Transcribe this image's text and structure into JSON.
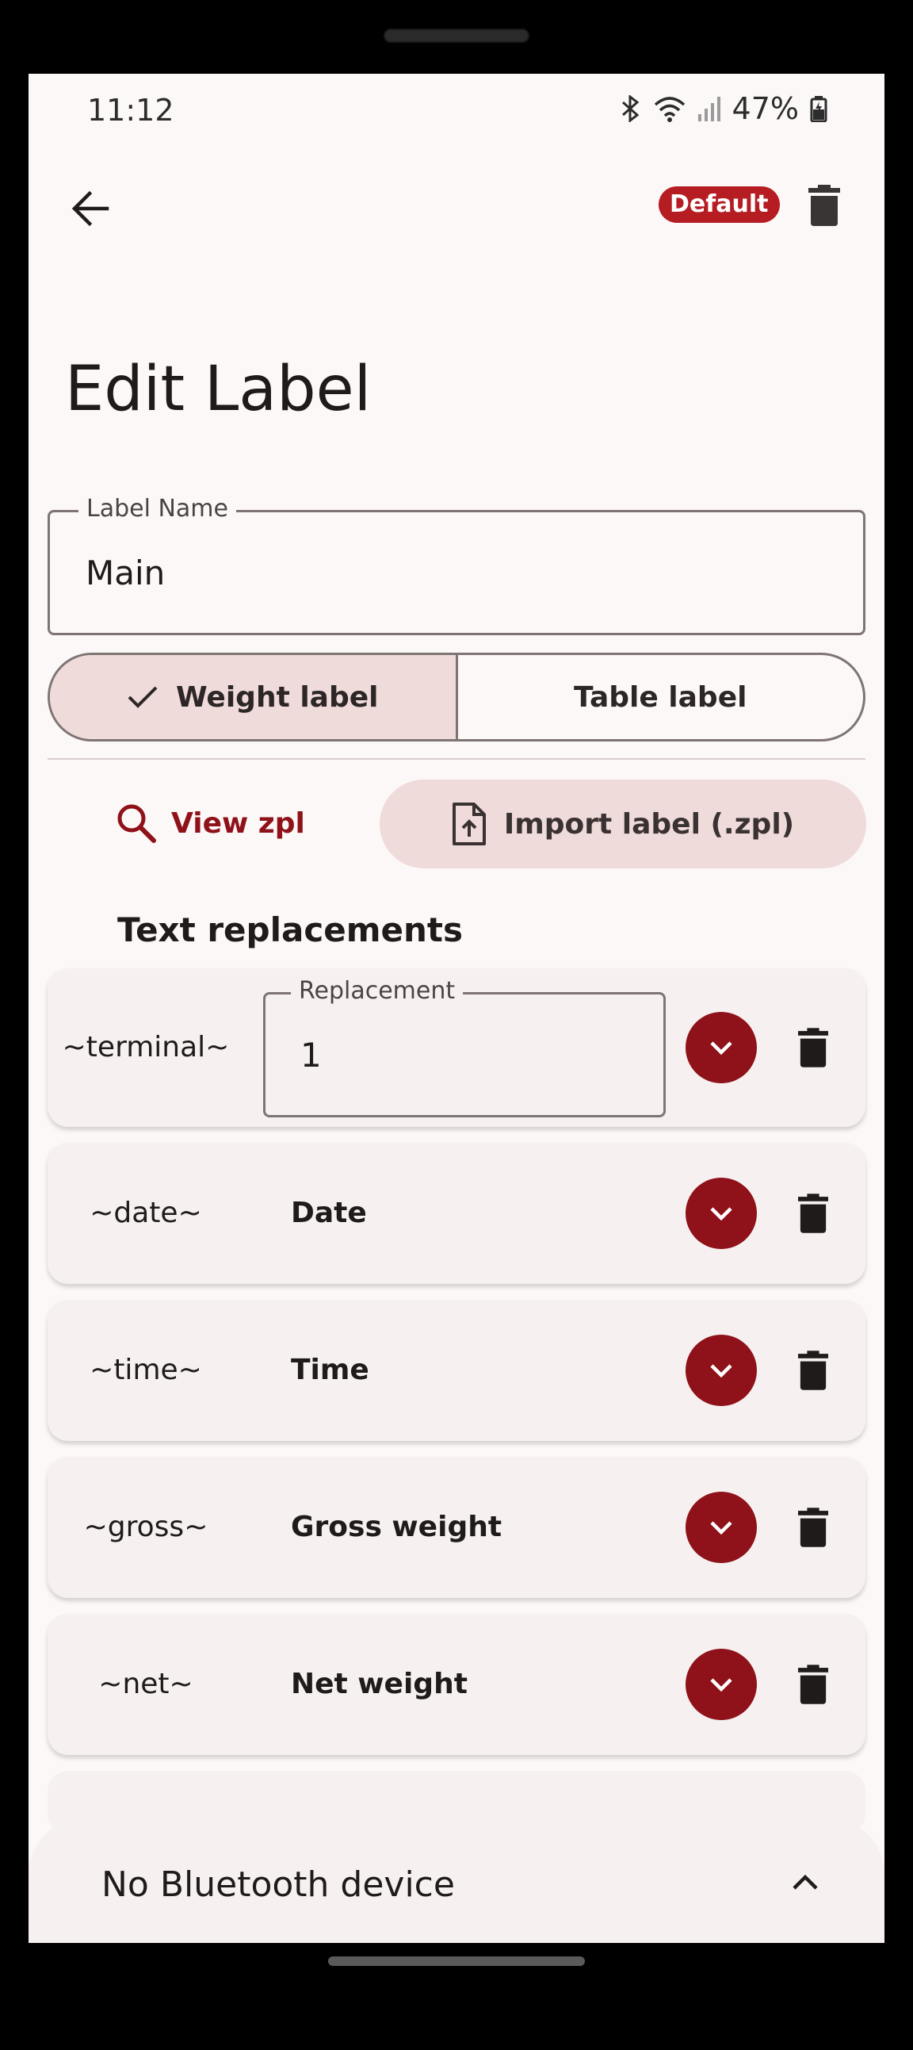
{
  "status_bar": {
    "time": "11:12",
    "battery": "47%"
  },
  "app_bar": {
    "badge": "Default"
  },
  "page": {
    "title": "Edit Label"
  },
  "label_name_field": {
    "label": "Label Name",
    "value": "Main"
  },
  "segmented": {
    "weight": "Weight label",
    "table": "Table label"
  },
  "actions": {
    "view_zpl": "View zpl",
    "import": "Import label (.zpl)"
  },
  "section": {
    "title": "Text replacements"
  },
  "replacements": [
    {
      "key": "~terminal~",
      "field_label": "Replacement",
      "value": "1"
    },
    {
      "key": "~date~",
      "desc": "Date"
    },
    {
      "key": "~time~",
      "desc": "Time"
    },
    {
      "key": "~gross~",
      "desc": "Gross weight"
    },
    {
      "key": "~net~",
      "desc": "Net weight"
    }
  ],
  "bluetooth": {
    "text": "No Bluetooth device"
  },
  "colors": {
    "accent": "#8f1119",
    "badge": "#b61d22",
    "tonal": "#efdbd9",
    "background": "#fcf8f7"
  },
  "icons": [
    "back-arrow-icon",
    "trash-icon",
    "check-icon",
    "search-icon",
    "file-upload-icon",
    "chevron-down-icon",
    "chevron-up-icon",
    "bluetooth-icon",
    "wifi-icon",
    "signal-icon",
    "battery-icon"
  ]
}
